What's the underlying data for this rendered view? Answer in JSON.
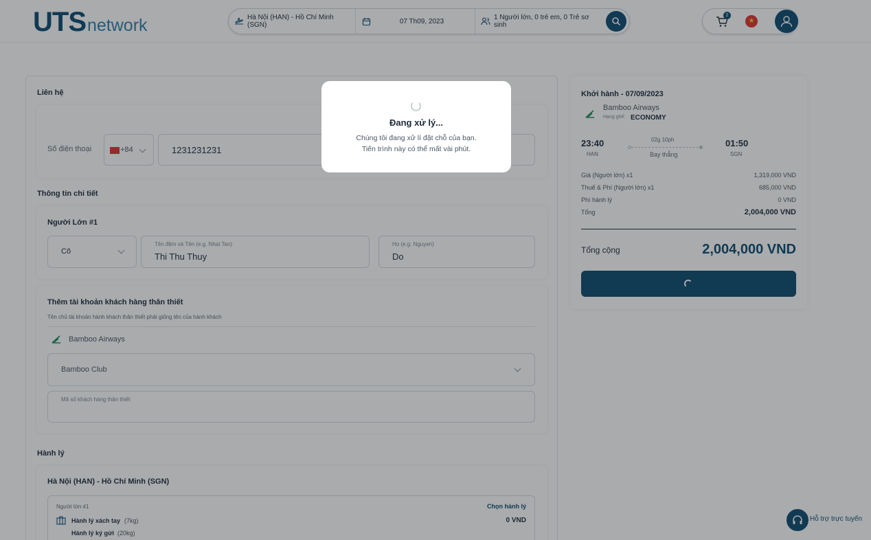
{
  "header": {
    "logo_main": "UTS",
    "logo_sub": "network",
    "search": {
      "route": "Hà Nội (HAN) - Hồ Chí Minh (SGN)",
      "date": "07 Th09, 2023",
      "passengers": "1 Người lớn, 0 trẻ em, 0 Trẻ sơ sinh"
    },
    "cart_count": "2"
  },
  "contact": {
    "section_title": "Liên hệ",
    "phone_label": "Số điện thoại",
    "country_code": "+84",
    "phone_value": "1231231231"
  },
  "details": {
    "section_title": "Thông tin chi tiết",
    "passenger_title": "Người Lớn #1",
    "title_value": "Cô",
    "given_name_label": "Tên đệm và Tên (e.g. Nhat Tan)",
    "given_name_value": "Thi Thu Thuy",
    "family_name_label": "Họ (e.g. Nguyen)",
    "family_name_value": "Do"
  },
  "loyalty": {
    "title": "Thêm tài khoản khách hàng thân thiết",
    "note": "Tên chủ tài khoản hành khách thân thiết phải giống tên của hành khách",
    "airline": "Bamboo Airways",
    "program": "Bamboo Club",
    "member_label": "Mã số khách hàng thân thiết"
  },
  "baggage": {
    "section_title": "Hành lý",
    "route": "Hà Nội (HAN) - Hồ Chí Minh (SGN)",
    "passenger": "Người lớn #1",
    "choose": "Chọn hành lý",
    "carry_on": "Hành lý xách tay",
    "carry_on_weight": "(7kg)",
    "checked": "Hành lý ký gửi",
    "checked_weight": "(20kg)",
    "price": "0 VND"
  },
  "summary": {
    "departure": "Khởi hành - 07/09/2023",
    "airline": "Bamboo Airways",
    "class_label": "Hạng ghế:",
    "class_value": "ECONOMY",
    "dep_time": "23:40",
    "dep_code": "HAN",
    "duration": "02g 10ph",
    "stops": "Bay thẳng",
    "arr_time": "01:50",
    "arr_code": "SGN",
    "lines": [
      {
        "label": "Giá (Người lớn) x1",
        "value": "1,319,000 VND"
      },
      {
        "label": "Thuế & Phí (Người lớn) x1",
        "value": "685,000 VND"
      },
      {
        "label": "Phí hành lý",
        "value": "0 VND"
      }
    ],
    "subtotal_label": "Tổng",
    "subtotal_value": "2,004,000 VND",
    "total_label": "Tổng cộng",
    "total_value": "2,004,000 VND"
  },
  "modal": {
    "title": "Đang xử lý...",
    "line1": "Chúng tôi đang xử lí đặt chỗ của bạn.",
    "line2": "Tiến trình này có thể mất vài phút."
  },
  "support": {
    "label": "Hỗ trợ trực tuyến"
  },
  "colors": {
    "brand": "#0b4a6f",
    "accent": "#2f7fa8"
  }
}
